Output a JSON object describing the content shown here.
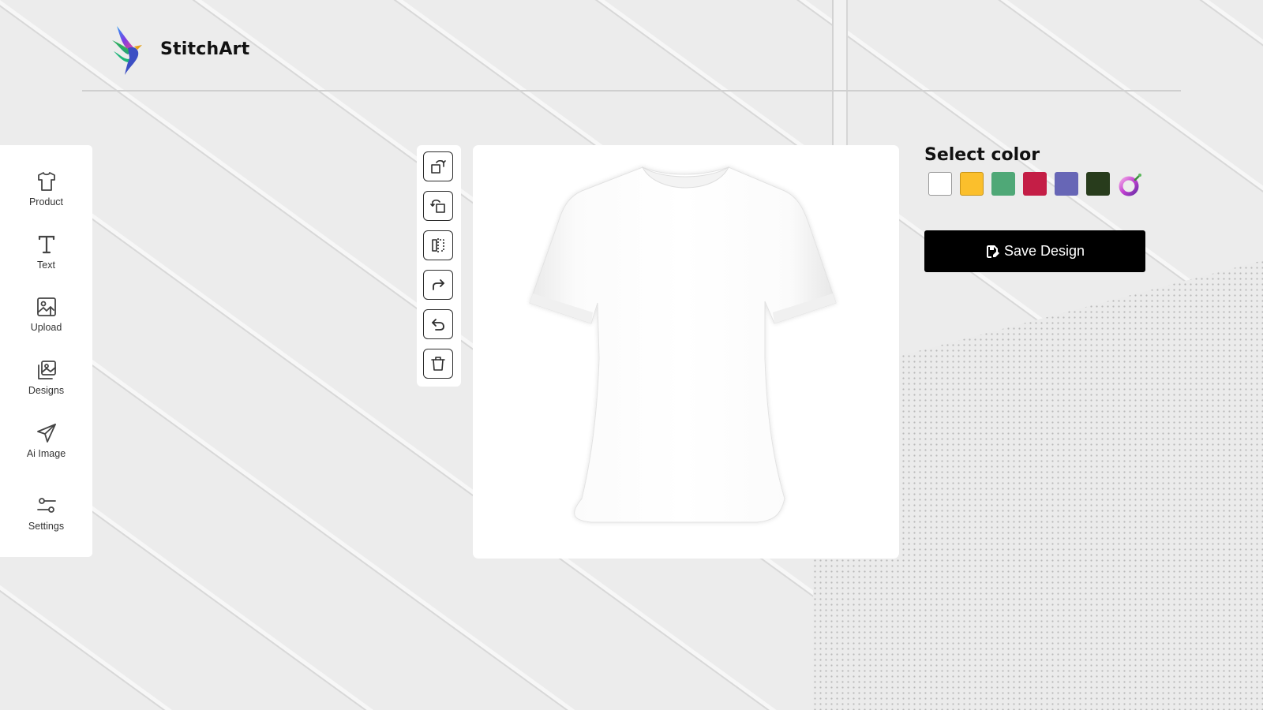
{
  "brand": {
    "name": "StitchArt"
  },
  "sidebar": {
    "items": [
      {
        "label": "Product",
        "icon": "tshirt-icon"
      },
      {
        "label": "Text",
        "icon": "text-icon"
      },
      {
        "label": "Upload",
        "icon": "image-upload-icon"
      },
      {
        "label": "Designs",
        "icon": "gallery-icon"
      },
      {
        "label": "Ai Image",
        "icon": "paper-plane-icon"
      },
      {
        "label": "Settings",
        "icon": "sliders-icon"
      }
    ]
  },
  "toolbar": {
    "tools": [
      "bring-forward-icon",
      "send-backward-icon",
      "flip-icon",
      "redo-icon",
      "undo-icon",
      "trash-icon"
    ]
  },
  "product": {
    "type": "t-shirt",
    "color": "#ffffff"
  },
  "color_picker": {
    "title": "Select color",
    "swatches": [
      "#ffffff",
      "#fbbf2c",
      "#4fa877",
      "#c41e46",
      "#6766b6",
      "#283c1c"
    ]
  },
  "save": {
    "label": "Save Design",
    "icon": "save-icon"
  }
}
